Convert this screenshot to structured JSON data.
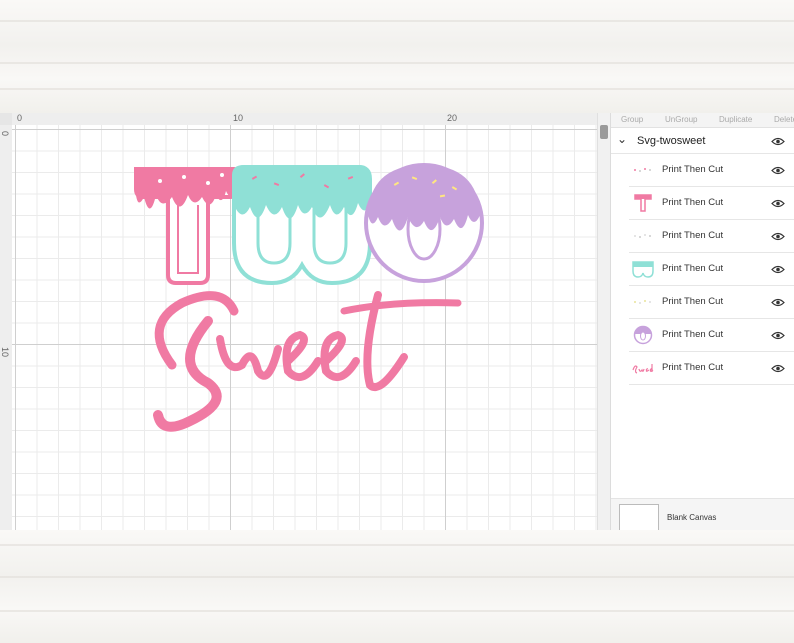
{
  "ruler": {
    "top_ticks": [
      "0",
      "10",
      "20"
    ],
    "left_ticks": [
      "0",
      "10"
    ]
  },
  "canvas": {
    "design_text_top": "TWO",
    "design_text_bottom": "Sweet"
  },
  "panel": {
    "toolbar": [
      "Group",
      "UnGroup",
      "Duplicate",
      "Delete"
    ],
    "group": {
      "label": "Svg-twosweet",
      "expanded": true
    },
    "layers": [
      {
        "label": "Print Then Cut",
        "thumb": "pink-sprinkles"
      },
      {
        "label": "Print Then Cut",
        "thumb": "pink-T"
      },
      {
        "label": "Print Then Cut",
        "thumb": "mint-sprinkles"
      },
      {
        "label": "Print Then Cut",
        "thumb": "mint-W"
      },
      {
        "label": "Print Then Cut",
        "thumb": "lilac-sprinkles"
      },
      {
        "label": "Print Then Cut",
        "thumb": "lilac-O"
      },
      {
        "label": "Print Then Cut",
        "thumb": "sweet-script"
      }
    ],
    "blank_canvas_label": "Blank Canvas"
  },
  "colors": {
    "pink": "#f07aa3",
    "mint": "#8fe0d6",
    "lilac": "#c7a2dc"
  }
}
